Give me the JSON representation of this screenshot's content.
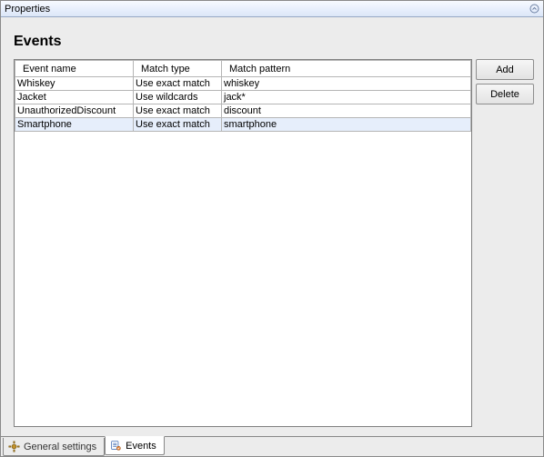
{
  "titlebar": {
    "title": "Properties"
  },
  "heading": "Events",
  "table": {
    "headers": {
      "name": "Event name",
      "matchType": "Match type",
      "matchPattern": "Match pattern"
    },
    "rows": [
      {
        "event_name": "Whiskey",
        "match_type": "Use exact match",
        "match_pattern": "whiskey"
      },
      {
        "event_name": "Jacket",
        "match_type": "Use wildcards",
        "match_pattern": "jack*"
      },
      {
        "event_name": "UnauthorizedDiscount",
        "match_type": "Use exact match",
        "match_pattern": "discount"
      },
      {
        "event_name": "Smartphone",
        "match_type": "Use exact match",
        "match_pattern": "smartphone"
      }
    ],
    "selected_index": 3
  },
  "buttons": {
    "add": "Add",
    "delete": "Delete"
  },
  "tabs": {
    "general": "General settings",
    "events": "Events"
  }
}
